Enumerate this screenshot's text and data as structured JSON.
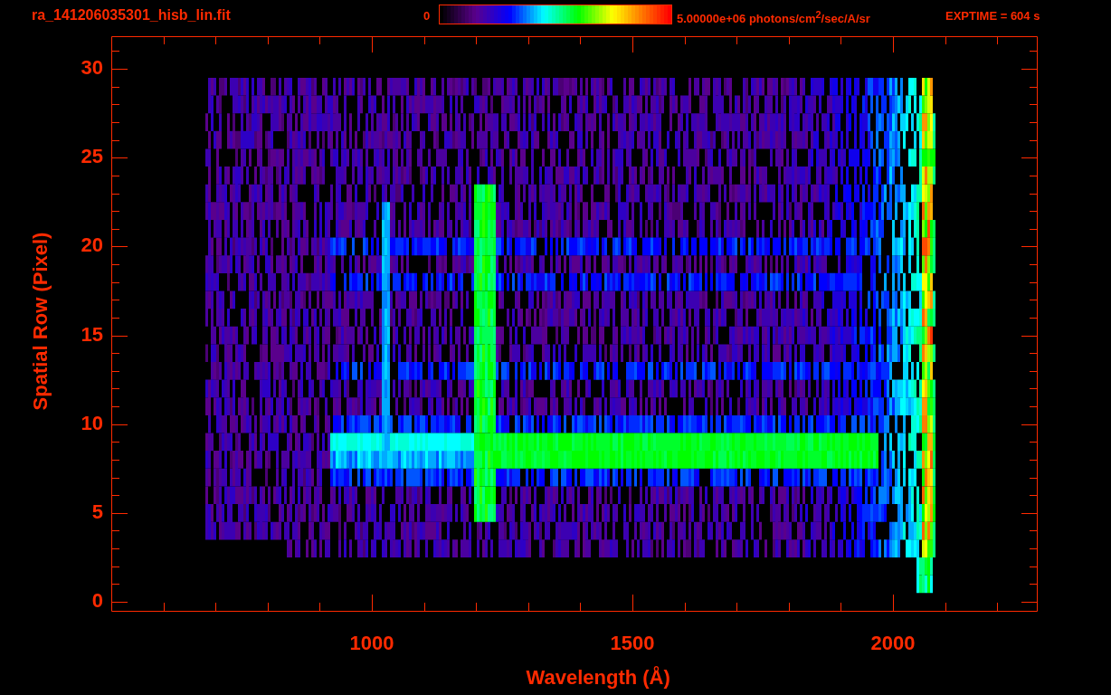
{
  "title": "ra_141206035301_hisb_lin.fit",
  "colorbar": {
    "min_label": "0",
    "max_label": "5.00000e+06 photons/cm$^{2}$/sec/A/sr"
  },
  "exposure": "EXPTIME = 604 s",
  "x_axis": {
    "label": "Wavelength (Å)",
    "ticks": [
      "1000",
      "1500",
      "2000"
    ]
  },
  "y_axis": {
    "label": "Spatial Row (Pixel)",
    "ticks": [
      "30",
      "25",
      "20",
      "15",
      "10",
      "5",
      "0"
    ]
  }
}
